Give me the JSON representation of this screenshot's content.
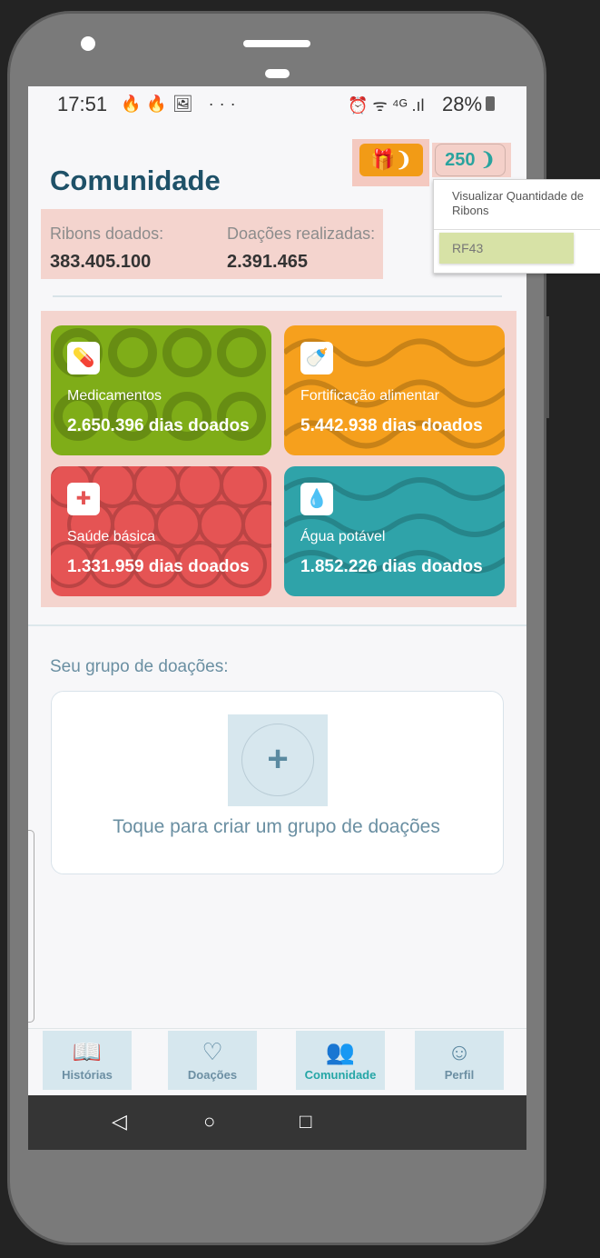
{
  "status_bar": {
    "time": "17:51",
    "left_icons": "🔥🔥🖼 ···",
    "right_icons": "⏰ ᯤ ⁴ᴳ .ıl",
    "battery_pct": "28%"
  },
  "header": {
    "title": "Comunidade",
    "ribbon_count": "250"
  },
  "stats": {
    "ribbons_label": "Ribons doados:",
    "ribbons_value": "383.405.100",
    "donations_label": "Doações realizadas:",
    "donations_value": "2.391.465"
  },
  "cards": [
    {
      "label": "Medicamentos",
      "value": "2.650.396 dias doados",
      "icon": "pill-icon",
      "color": "#7fad18"
    },
    {
      "label": "Fortificação alimentar",
      "value": "5.442.938 dias doados",
      "icon": "baby-bottle-icon",
      "color": "#f6a01d"
    },
    {
      "label": "Saúde básica",
      "value": "1.331.959 dias doados",
      "icon": "medical-kit-icon",
      "color": "#e55454"
    },
    {
      "label": "Água potável",
      "value": "1.852.226 dias doados",
      "icon": "water-drop-icon",
      "color": "#2fa3a9"
    }
  ],
  "group": {
    "label": "Seu grupo de doações:",
    "cta": "Toque para criar um grupo de doações"
  },
  "nav": [
    {
      "label": "Histórias",
      "icon": "book-icon"
    },
    {
      "label": "Doações",
      "icon": "heart-icon"
    },
    {
      "label": "Comunidade",
      "icon": "people-icon",
      "active": true
    },
    {
      "label": "Perfil",
      "icon": "face-icon"
    }
  ],
  "dropdown": {
    "title": "Visualizar Quantidade de Ribons",
    "item": "RF43"
  }
}
